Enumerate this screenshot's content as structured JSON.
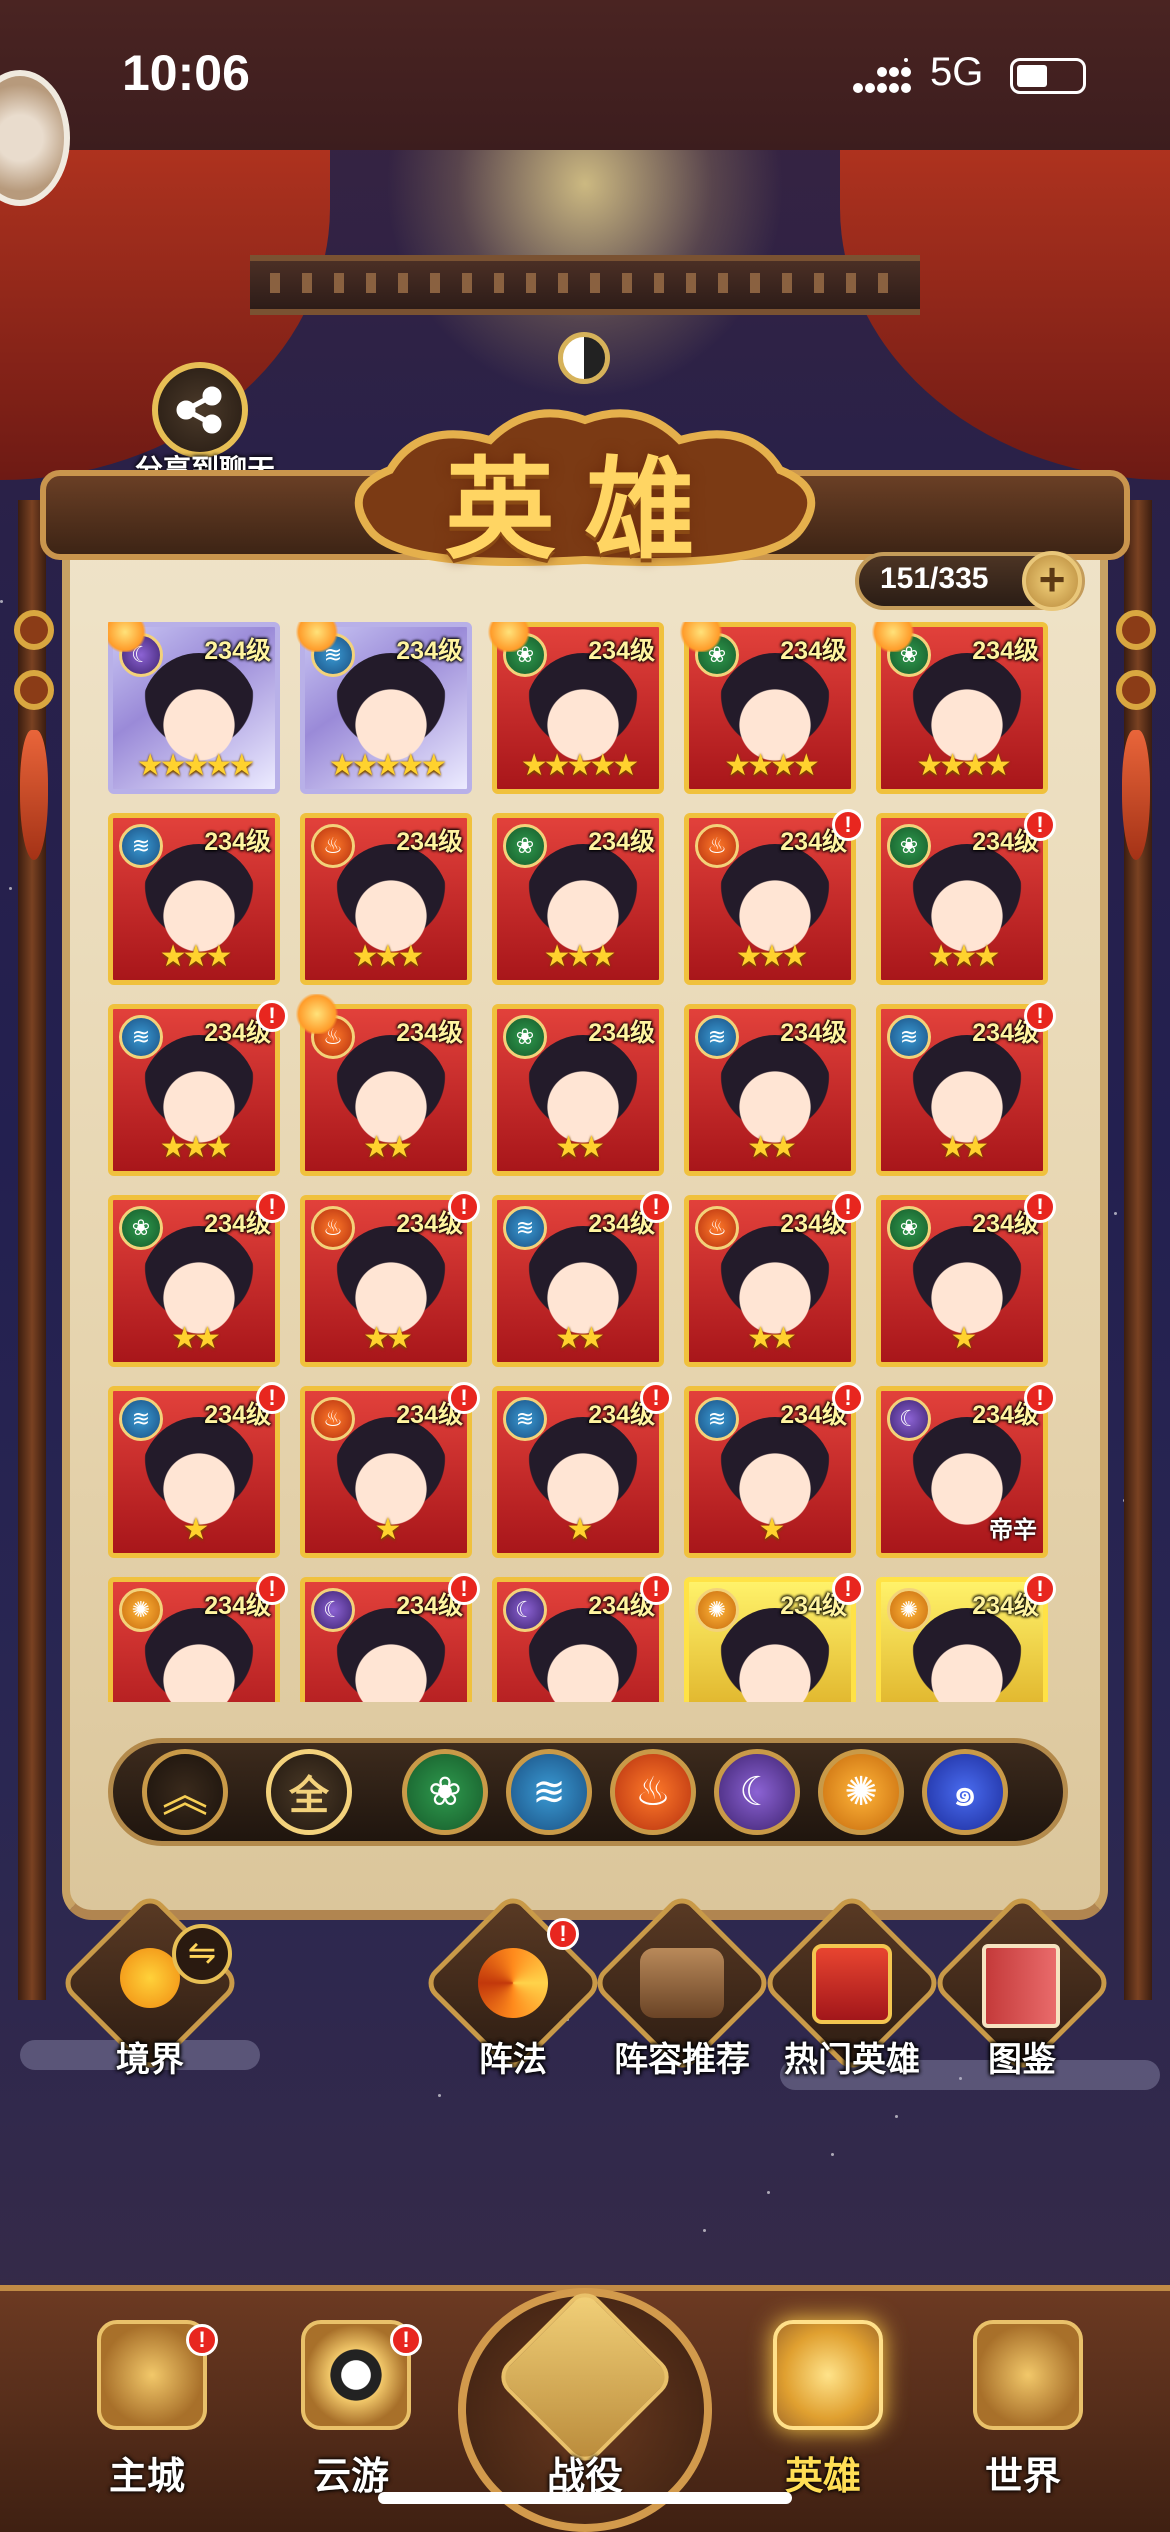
{
  "status_bar": {
    "time": "10:06",
    "network": "5G"
  },
  "share": {
    "label": "分享到聊天"
  },
  "title": "英雄",
  "counter": {
    "text": "151/335",
    "add": "+"
  },
  "heroes": [
    {
      "level": "234级",
      "element": "moon",
      "frame": "purple",
      "stars": "★★★★★",
      "crown": true,
      "alert": false
    },
    {
      "level": "234级",
      "element": "water",
      "frame": "purple",
      "stars": "★★★★★",
      "crown": true,
      "alert": false
    },
    {
      "level": "234级",
      "element": "wind",
      "frame": "red",
      "stars": "★★★★★",
      "crown": true,
      "alert": false
    },
    {
      "level": "234级",
      "element": "wind",
      "frame": "red",
      "stars": "★★★★",
      "crown": true,
      "alert": false
    },
    {
      "level": "234级",
      "element": "wind",
      "frame": "red",
      "stars": "★★★★",
      "crown": true,
      "alert": false
    },
    {
      "level": "234级",
      "element": "water",
      "frame": "red",
      "stars": "★★★",
      "crown": false,
      "alert": false
    },
    {
      "level": "234级",
      "element": "fire",
      "frame": "red",
      "stars": "★★★",
      "crown": false,
      "alert": false
    },
    {
      "level": "234级",
      "element": "wind",
      "frame": "red",
      "stars": "★★★",
      "crown": false,
      "alert": false
    },
    {
      "level": "234级",
      "element": "fire",
      "frame": "red",
      "stars": "★★★",
      "crown": false,
      "alert": true
    },
    {
      "level": "234级",
      "element": "wind",
      "frame": "red",
      "stars": "★★★",
      "crown": false,
      "alert": true
    },
    {
      "level": "234级",
      "element": "water",
      "frame": "red",
      "stars": "★★★",
      "crown": false,
      "alert": true
    },
    {
      "level": "234级",
      "element": "fire",
      "frame": "red",
      "stars": "★★",
      "crown": true,
      "alert": false
    },
    {
      "level": "234级",
      "element": "wind",
      "frame": "red",
      "stars": "★★",
      "crown": false,
      "alert": false
    },
    {
      "level": "234级",
      "element": "water",
      "frame": "red",
      "stars": "★★",
      "crown": false,
      "alert": false
    },
    {
      "level": "234级",
      "element": "water",
      "frame": "red",
      "stars": "★★",
      "crown": false,
      "alert": true
    },
    {
      "level": "234级",
      "element": "wind",
      "frame": "red",
      "stars": "★★",
      "crown": false,
      "alert": true
    },
    {
      "level": "234级",
      "element": "fire",
      "frame": "red",
      "stars": "★★",
      "crown": false,
      "alert": true
    },
    {
      "level": "234级",
      "element": "water",
      "frame": "red",
      "stars": "★★",
      "crown": false,
      "alert": true
    },
    {
      "level": "234级",
      "element": "fire",
      "frame": "red",
      "stars": "★★",
      "crown": false,
      "alert": true
    },
    {
      "level": "234级",
      "element": "wind",
      "frame": "red",
      "stars": "★",
      "crown": false,
      "alert": true
    },
    {
      "level": "234级",
      "element": "water",
      "frame": "red",
      "stars": "★",
      "crown": false,
      "alert": true
    },
    {
      "level": "234级",
      "element": "fire",
      "frame": "red",
      "stars": "★",
      "crown": false,
      "alert": true
    },
    {
      "level": "234级",
      "element": "water",
      "frame": "red",
      "stars": "★",
      "crown": false,
      "alert": true
    },
    {
      "level": "234级",
      "element": "water",
      "frame": "red",
      "stars": "★",
      "crown": false,
      "alert": true
    },
    {
      "level": "234级",
      "element": "moon",
      "frame": "red",
      "stars": "",
      "crown": false,
      "alert": true,
      "name": "帝辛"
    },
    {
      "level": "234级",
      "element": "sun",
      "frame": "red",
      "stars": "",
      "crown": false,
      "alert": true
    },
    {
      "level": "234级",
      "element": "moon",
      "frame": "red",
      "stars": "",
      "crown": false,
      "alert": true
    },
    {
      "level": "234级",
      "element": "moon",
      "frame": "red",
      "stars": "",
      "crown": false,
      "alert": true
    },
    {
      "level": "234级",
      "element": "sun",
      "frame": "gold",
      "stars": "",
      "crown": false,
      "alert": true
    },
    {
      "level": "234级",
      "element": "sun",
      "frame": "gold",
      "stars": "",
      "crown": false,
      "alert": true
    }
  ],
  "filters": {
    "all_label": "全",
    "elements": [
      "wind",
      "water",
      "fire",
      "moon",
      "sun",
      "vortex"
    ]
  },
  "functions": {
    "realm": "境界",
    "formation": "阵法",
    "lineup": "阵容推荐",
    "popular": "热门英雄",
    "codex": "图鉴",
    "alert_mark": "!"
  },
  "nav": {
    "main_city": "主城",
    "travel": "云游",
    "battle": "战役",
    "heroes": "英雄",
    "world": "世界"
  },
  "colors": {
    "accent_gold": "#f0c13d",
    "alert_red": "#e8261f",
    "panel_parchment": "#efe3c8"
  }
}
